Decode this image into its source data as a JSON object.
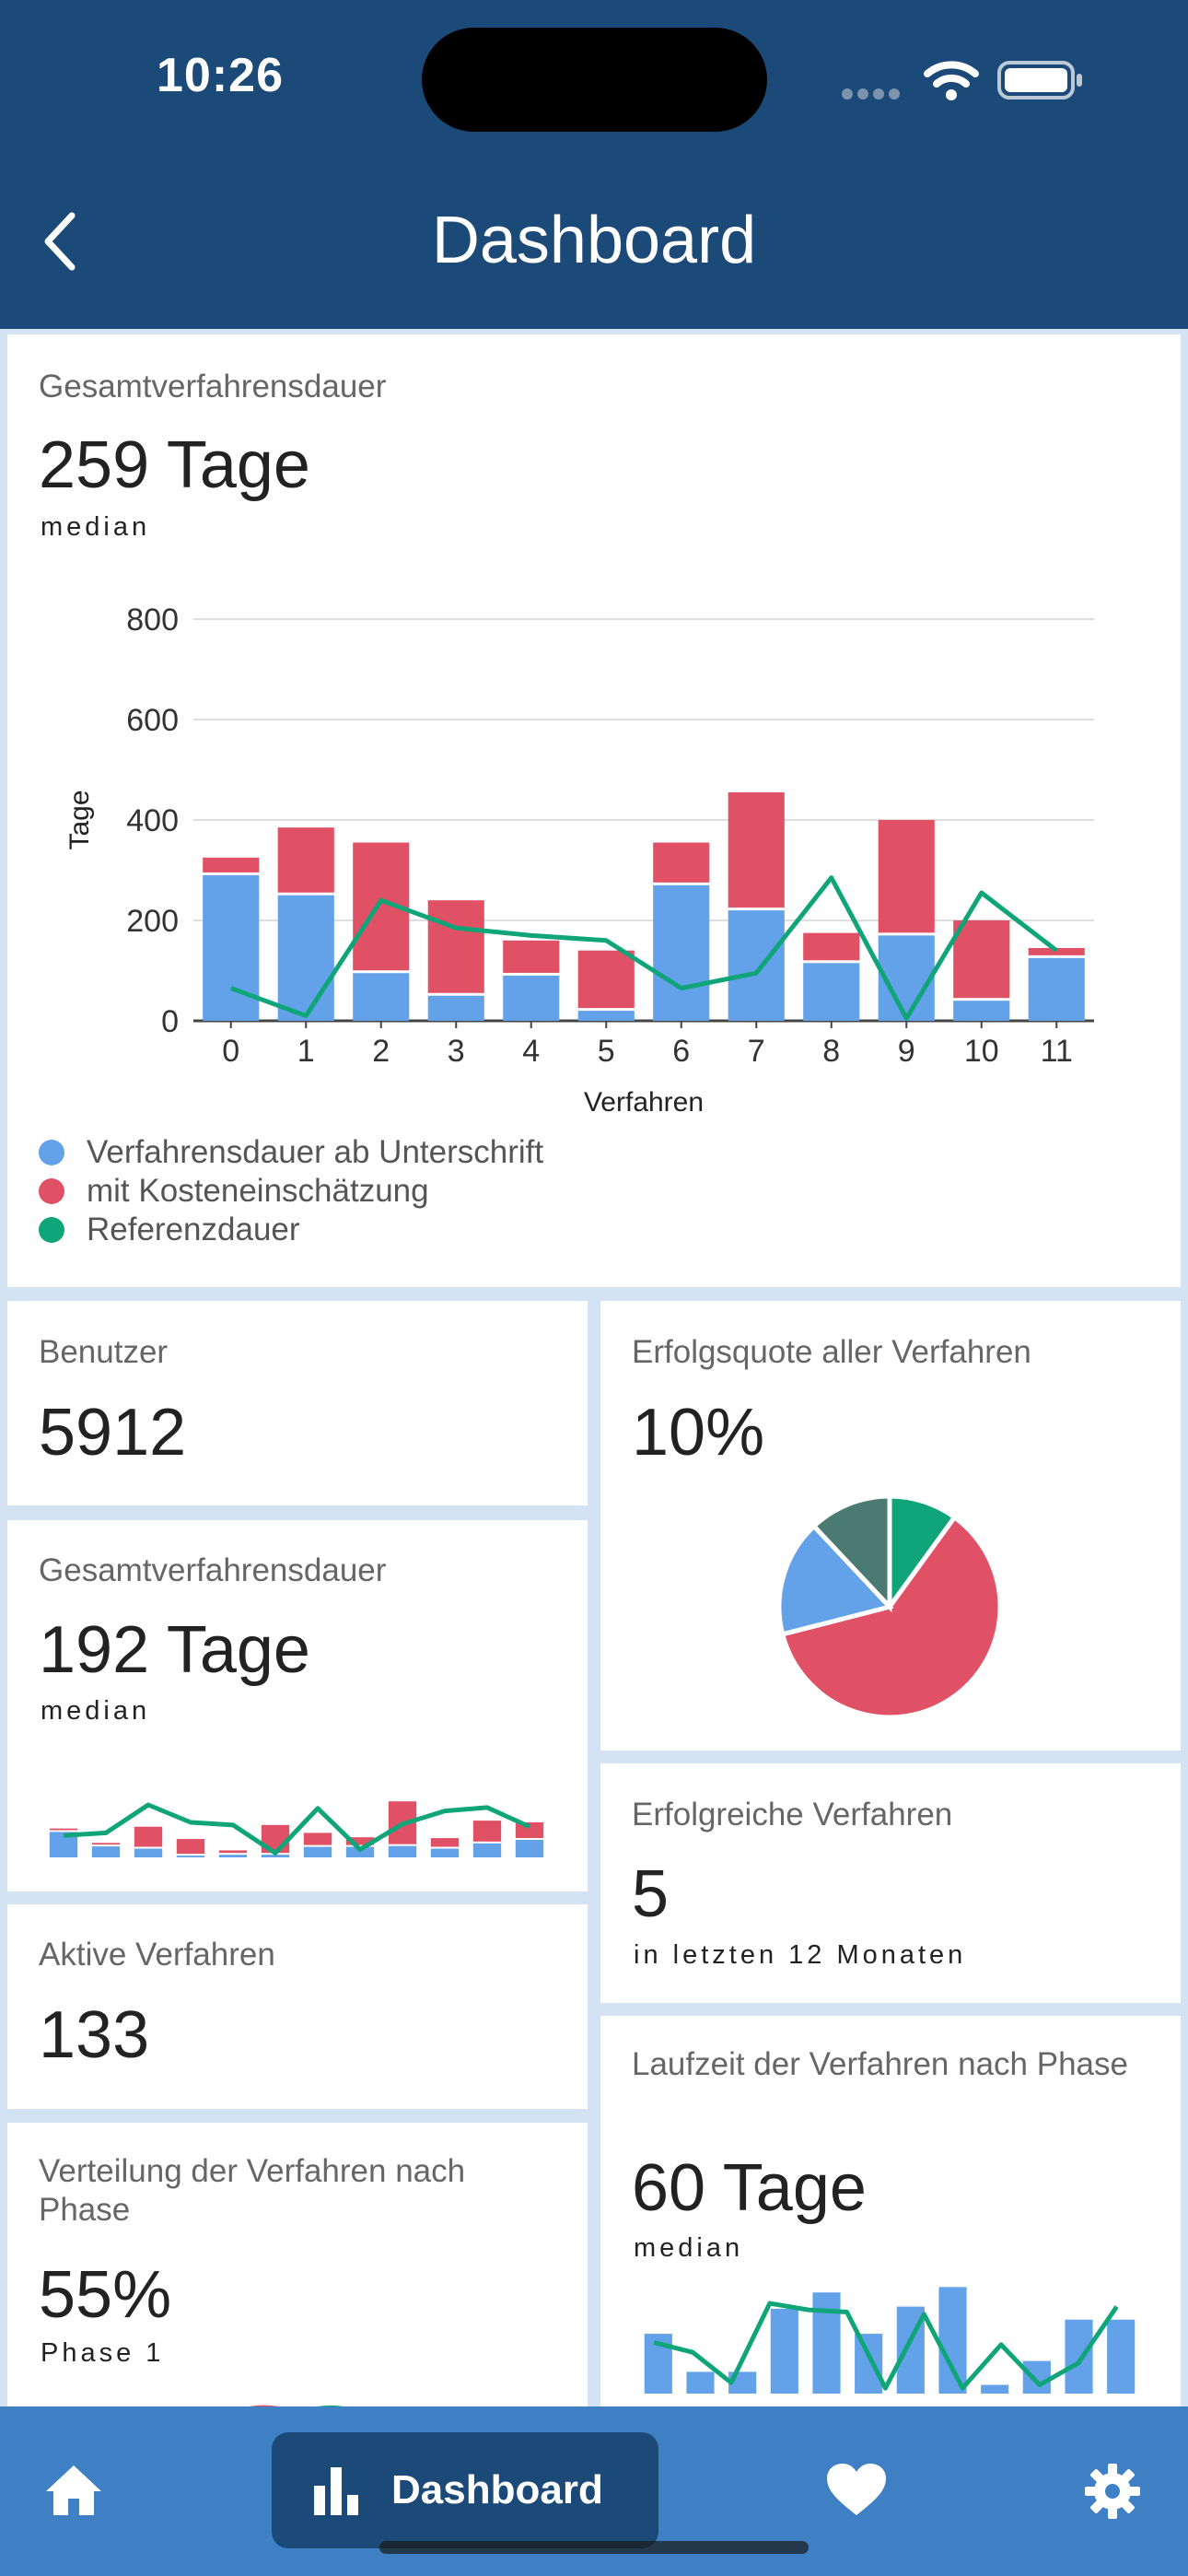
{
  "status_bar": {
    "time": "10:26"
  },
  "nav": {
    "title": "Dashboard",
    "back_icon": "chevron-left-icon"
  },
  "colors": {
    "nav_bg": "#1c4a78",
    "tab_bg": "#3f7fc4",
    "series_blue": "#63a1e9",
    "series_red": "#e05166",
    "series_green": "#0fa579",
    "pie_teal": "#4a7a72"
  },
  "main_card": {
    "title": "Gesamtverfahrensdauer",
    "value": "259 Tage",
    "sub": "median",
    "legend": [
      {
        "label": "Verfahrensdauer ab Unterschrift",
        "color": "#63a1e9"
      },
      {
        "label": "mit Kosteneinschätzung",
        "color": "#e05166"
      },
      {
        "label": "Referenzdauer",
        "color": "#0fa579"
      }
    ]
  },
  "users_card": {
    "title": "Benutzer",
    "value": "5912"
  },
  "success_rate_card": {
    "title": "Erfolgsquote aller Verfahren",
    "value": "10%"
  },
  "duration_card_small": {
    "title": "Gesamtverfahrensdauer",
    "value": "192 Tage",
    "sub": "median"
  },
  "successful_card": {
    "title": "Erfolgreiche Verfahren",
    "value": "5",
    "sub": "in letzten 12 Monaten"
  },
  "active_card": {
    "title": "Aktive Verfahren",
    "value": "133"
  },
  "runtime_card": {
    "title": "Laufzeit der Verfahren nach Phase",
    "value": "60 Tage",
    "sub": "median"
  },
  "distribution_card": {
    "title": "Verteilung der Verfahren nach Phase",
    "value": "55%",
    "sub": "Phase 1"
  },
  "tab_bar": {
    "dashboard_label": "Dashboard",
    "items": [
      "home-icon",
      "bar-chart-icon",
      "heart-icon",
      "gear-icon"
    ]
  },
  "chart_data": [
    {
      "type": "bar",
      "stacked": true,
      "xlabel": "Verfahren",
      "ylabel": "Tage",
      "categories": [
        "0",
        "1",
        "2",
        "3",
        "4",
        "5",
        "6",
        "7",
        "8",
        "9",
        "10",
        "11"
      ],
      "ylim": [
        0,
        800
      ],
      "yticks": [
        0,
        200,
        400,
        600,
        800
      ],
      "grid": true,
      "legend_position": "bottom-left",
      "series": [
        {
          "name": "Verfahrensdauer ab Unterschrift",
          "kind": "bar",
          "values": [
            290,
            250,
            95,
            50,
            90,
            20,
            270,
            220,
            115,
            170,
            40,
            125
          ]
        },
        {
          "name": "mit Kosteneinschätzung",
          "kind": "bar",
          "values": [
            35,
            135,
            260,
            190,
            70,
            120,
            85,
            235,
            60,
            230,
            160,
            20
          ]
        },
        {
          "name": "Referenzdauer",
          "kind": "line",
          "values": [
            65,
            10,
            240,
            185,
            170,
            160,
            65,
            95,
            285,
            5,
            255,
            140
          ]
        }
      ]
    },
    {
      "type": "pie",
      "slices": [
        {
          "value": 10,
          "color": "#0fa579"
        },
        {
          "value": 61,
          "color": "#e05166"
        },
        {
          "value": 17,
          "color": "#63a1e9"
        },
        {
          "value": 12,
          "color": "#4a7a72"
        }
      ]
    },
    {
      "type": "bar",
      "stacked": true,
      "categories": [
        "0",
        "1",
        "2",
        "3",
        "4",
        "5",
        "6",
        "7",
        "8",
        "9",
        "10",
        "11"
      ],
      "series": [
        {
          "kind": "bar",
          "values": [
            290,
            125,
            100,
            20,
            30,
            30,
            120,
            120,
            130,
            100,
            160,
            200
          ]
        },
        {
          "kind": "bar",
          "values": [
            40,
            40,
            250,
            190,
            50,
            340,
            160,
            110,
            510,
            120,
            260,
            200
          ]
        },
        {
          "kind": "line",
          "values": [
            250,
            280,
            600,
            400,
            370,
            50,
            560,
            90,
            380,
            530,
            570,
            350
          ]
        }
      ]
    },
    {
      "type": "bar",
      "categories": [
        "0",
        "1",
        "2",
        "3",
        "4",
        "5",
        "6",
        "7",
        "8",
        "9",
        "10",
        "11",
        "12"
      ],
      "series": [
        {
          "kind": "bar",
          "values": [
            0.55,
            0.2,
            0.2,
            0.78,
            0.93,
            0.55,
            0.8,
            0.98,
            0.08,
            0.3,
            0.68,
            0.68
          ]
        },
        {
          "kind": "line",
          "values": [
            0.47,
            0.38,
            0.1,
            0.83,
            0.77,
            0.75,
            0.05,
            0.73,
            0.05,
            0.45,
            0.08,
            0.28,
            0.8
          ]
        }
      ]
    }
  ]
}
